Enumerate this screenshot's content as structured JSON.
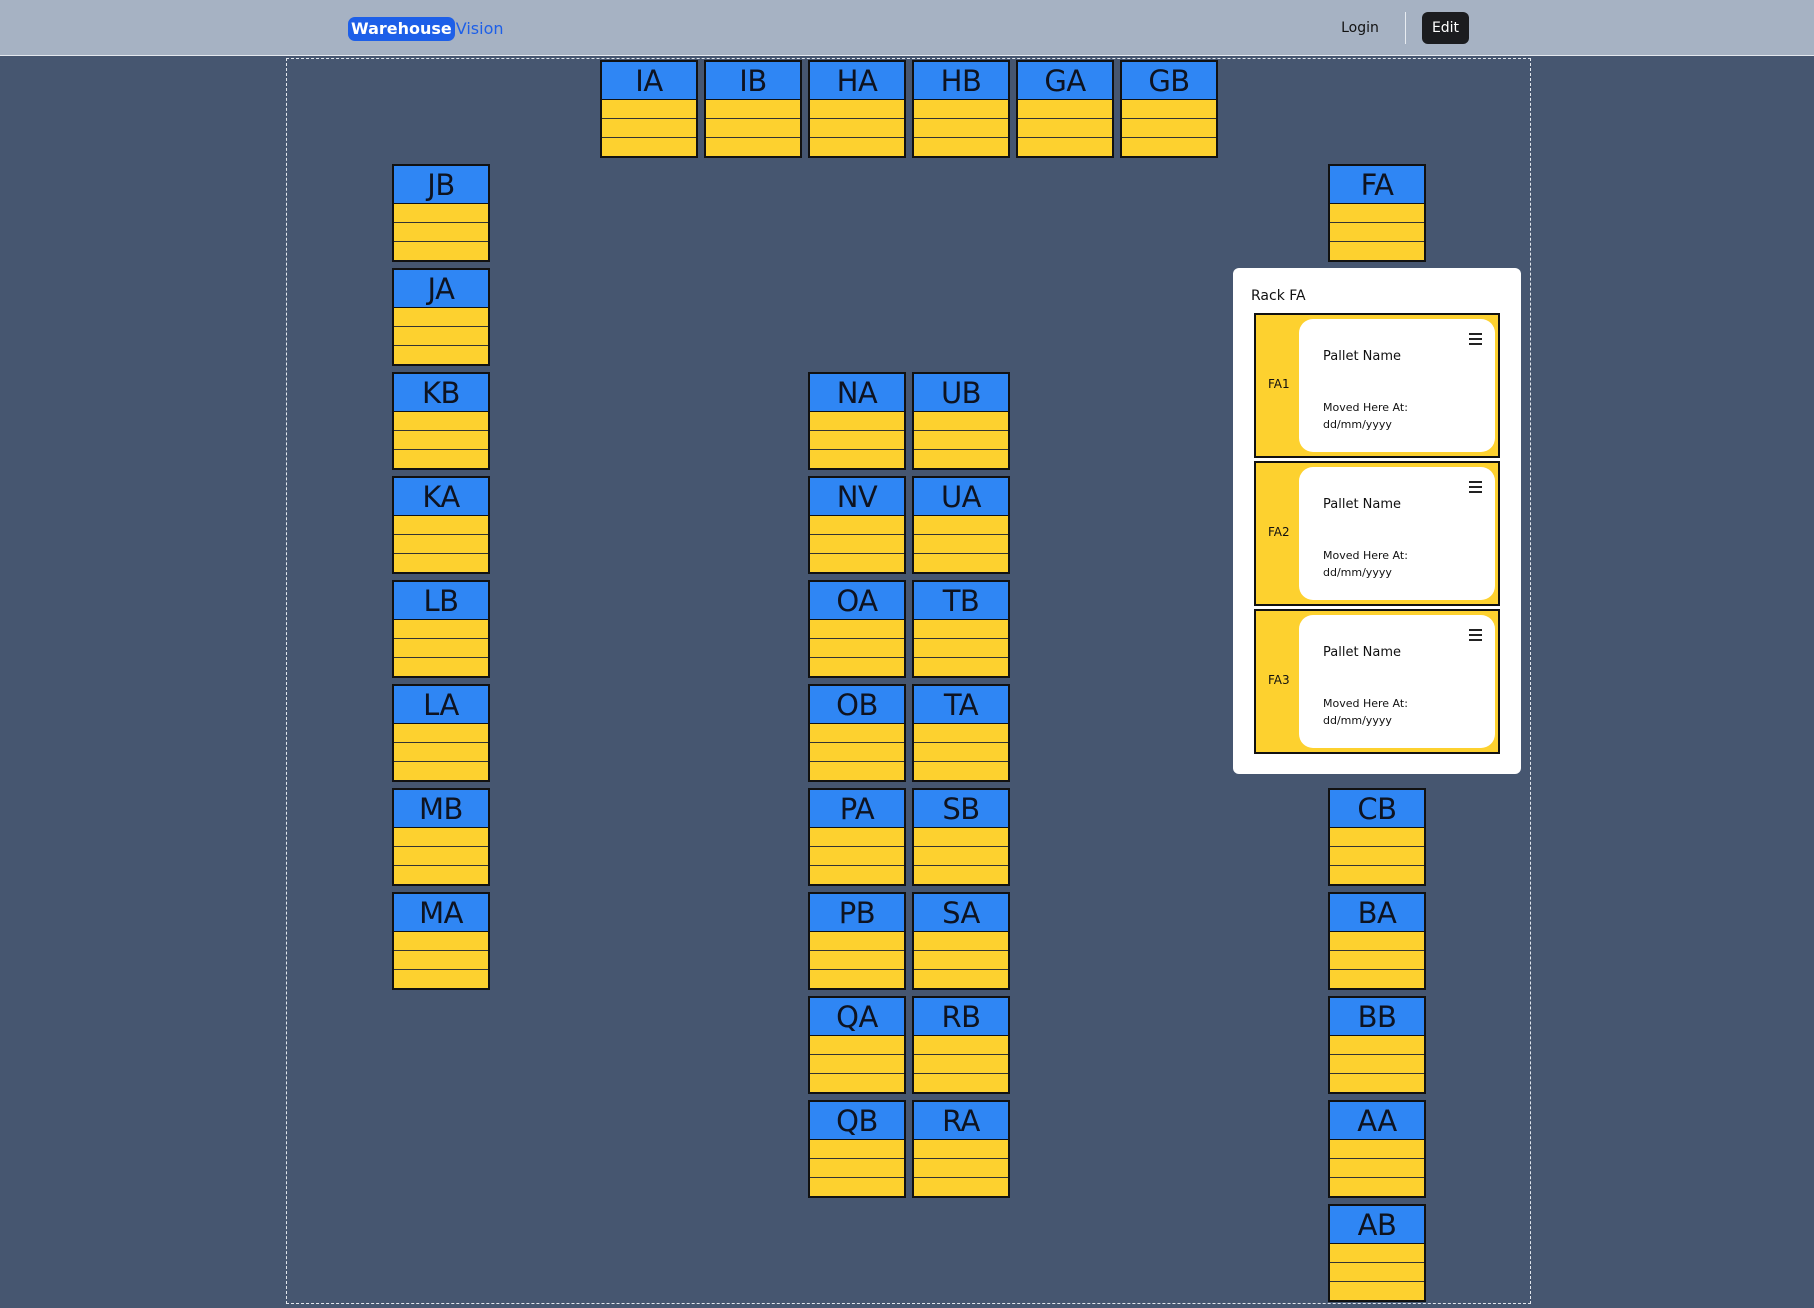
{
  "app": {
    "brand_part1": "Warehouse",
    "brand_part2": "Vision"
  },
  "nav": {
    "login_label": "Login",
    "edit_label": "Edit"
  },
  "colors": {
    "rack_header": "#2f86f4",
    "rack_slot": "#fdd12f",
    "background": "#465670",
    "navbar": "#a6b2c3",
    "brand": "#1d5fe8"
  },
  "racks": [
    {
      "id": "IA"
    },
    {
      "id": "IB"
    },
    {
      "id": "HA"
    },
    {
      "id": "HB"
    },
    {
      "id": "GA"
    },
    {
      "id": "GB"
    },
    {
      "id": "JB"
    },
    {
      "id": "JA"
    },
    {
      "id": "KB"
    },
    {
      "id": "KA"
    },
    {
      "id": "LB"
    },
    {
      "id": "LA"
    },
    {
      "id": "MB"
    },
    {
      "id": "MA"
    },
    {
      "id": "NA"
    },
    {
      "id": "NV"
    },
    {
      "id": "OA"
    },
    {
      "id": "OB"
    },
    {
      "id": "PA"
    },
    {
      "id": "PB"
    },
    {
      "id": "QA"
    },
    {
      "id": "QB"
    },
    {
      "id": "UB"
    },
    {
      "id": "UA"
    },
    {
      "id": "TB"
    },
    {
      "id": "TA"
    },
    {
      "id": "SB"
    },
    {
      "id": "SA"
    },
    {
      "id": "RB"
    },
    {
      "id": "RA"
    },
    {
      "id": "FA"
    },
    {
      "id": "CB"
    },
    {
      "id": "BA"
    },
    {
      "id": "BB"
    },
    {
      "id": "AA"
    },
    {
      "id": "AB"
    }
  ],
  "rack_panel": {
    "title": "Rack FA",
    "levels": [
      {
        "label": "FA1",
        "pallet_name": "Pallet Name",
        "moved_at": "Moved Here At: dd/mm/yyyy"
      },
      {
        "label": "FA2",
        "pallet_name": "Pallet Name",
        "moved_at": "Moved Here At: dd/mm/yyyy"
      },
      {
        "label": "FA3",
        "pallet_name": "Pallet Name",
        "moved_at": "Moved Here At: dd/mm/yyyy"
      }
    ]
  }
}
